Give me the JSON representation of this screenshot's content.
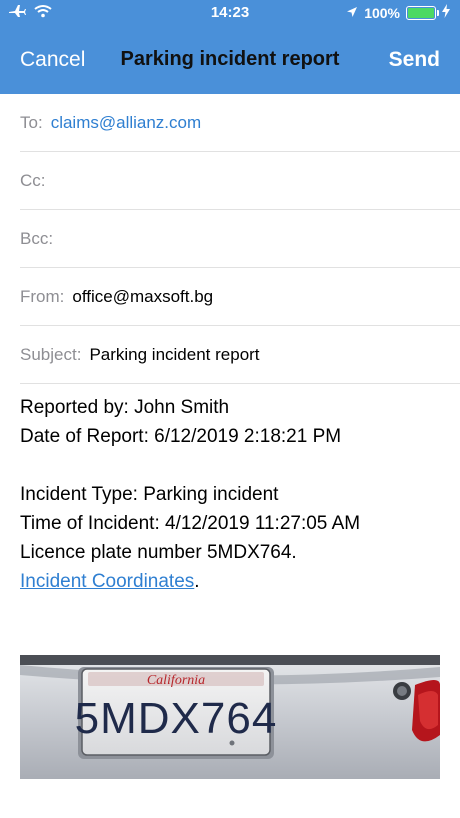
{
  "status": {
    "time": "14:23",
    "battery_text": "100%",
    "battery_level": 1.0
  },
  "nav": {
    "cancel": "Cancel",
    "title": "Parking incident report",
    "send": "Send"
  },
  "fields": {
    "to_label": "To:",
    "to_value": "claims@allianz.com",
    "cc_label": "Cc:",
    "bcc_label": "Bcc:",
    "from_label": "From:",
    "from_value": "office@maxsoft.bg",
    "subject_label": "Subject:",
    "subject_value": "Parking incident report"
  },
  "body": {
    "reported_by": "Reported by: John Smith",
    "date_of_report": "Date of Report: 6/12/2019 2:18:21 PM",
    "incident_type": "Incident Type: Parking incident",
    "time_of_incident": "Time of Incident: 4/12/2019 11:27:05 AM",
    "licence_plate": "Licence plate number 5MDX764.",
    "coordinates_link": "Incident Coordinates",
    "coordinates_suffix": "."
  },
  "photo": {
    "plate_state": "California",
    "plate_number": "5MDX764"
  },
  "colors": {
    "header": "#4a90d9",
    "link": "#2f7fd1",
    "battery": "#4cd964"
  }
}
